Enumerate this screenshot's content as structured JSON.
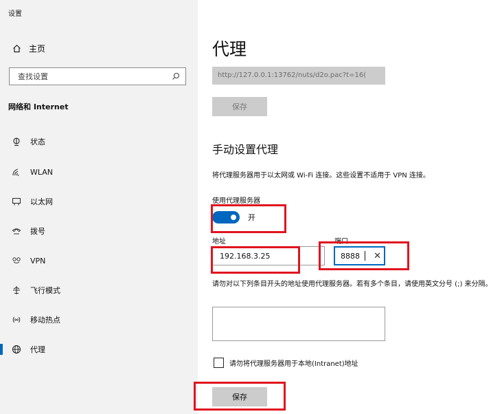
{
  "window": {
    "title": "设置"
  },
  "sidebar": {
    "home": {
      "label": "主页",
      "icon": "home-icon"
    },
    "search": {
      "placeholder": "查找设置",
      "icon": "search-icon"
    },
    "section_title": "网络和 Internet",
    "items": [
      {
        "label": "状态",
        "icon": "status-icon"
      },
      {
        "label": "WLAN",
        "icon": "wifi-icon"
      },
      {
        "label": "以太网",
        "icon": "ethernet-icon"
      },
      {
        "label": "拨号",
        "icon": "dialup-icon"
      },
      {
        "label": "VPN",
        "icon": "vpn-icon"
      },
      {
        "label": "飞行模式",
        "icon": "airplane-icon"
      },
      {
        "label": "移动热点",
        "icon": "hotspot-icon"
      },
      {
        "label": "代理",
        "icon": "globe-icon",
        "active": true
      }
    ]
  },
  "main": {
    "title": "代理",
    "auto_script_url": "http://127.0.0.1:13762/nuts/d2o.pac?t=16(",
    "auto_save_label": "保存",
    "manual": {
      "title": "手动设置代理",
      "description": "将代理服务器用于以太网或 Wi-Fi 连接。这些设置不适用于 VPN 连接。",
      "use_proxy_label": "使用代理服务器",
      "toggle_state": "开",
      "address_label": "地址",
      "address_value": "192.168.3.25",
      "port_label": "端口",
      "port_value": "8888",
      "exceptions_description": "请勿对以下列条目开头的地址使用代理服务器。若有多个条目，请使用英文分号 (;) 来分隔。",
      "exceptions_value": "",
      "local_checkbox_label": "请勿将代理服务器用于本地(Intranet)地址",
      "local_checkbox_checked": false,
      "save_label": "保存"
    }
  },
  "colors": {
    "accent": "#0067c0",
    "highlight": "#e0141e",
    "sidebar_bg": "#f2f2f2",
    "disabled_bg": "#cccccc"
  }
}
